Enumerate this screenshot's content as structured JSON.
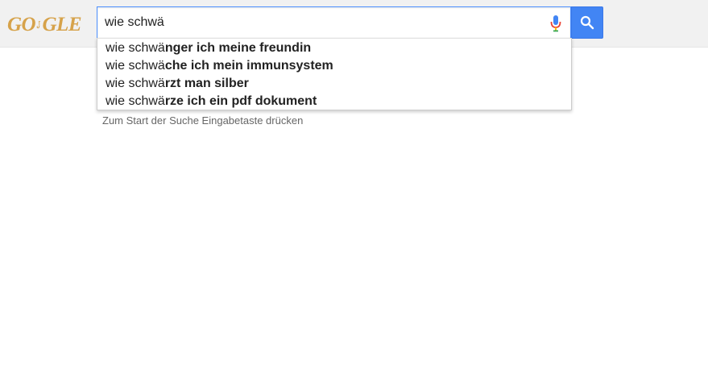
{
  "logo": {
    "text_left": "GO",
    "text_right": "GLE"
  },
  "search": {
    "value": "wie schwä",
    "button_icon": "search-icon",
    "mic_icon": "microphone-icon"
  },
  "suggestions": [
    {
      "prefix": "wie schwä",
      "completion": "nger ich meine freundin"
    },
    {
      "prefix": "wie schwä",
      "completion": "che ich mein immunsystem"
    },
    {
      "prefix": "wie schwä",
      "completion": "rzt man silber"
    },
    {
      "prefix": "wie schwä",
      "completion": "rze ich ein pdf dokument"
    }
  ],
  "hint": "Zum Start der Suche Eingabetaste drücken",
  "colors": {
    "accent": "#4285f4",
    "logo": "#d6a24a",
    "topbar": "#f1f1f1"
  }
}
